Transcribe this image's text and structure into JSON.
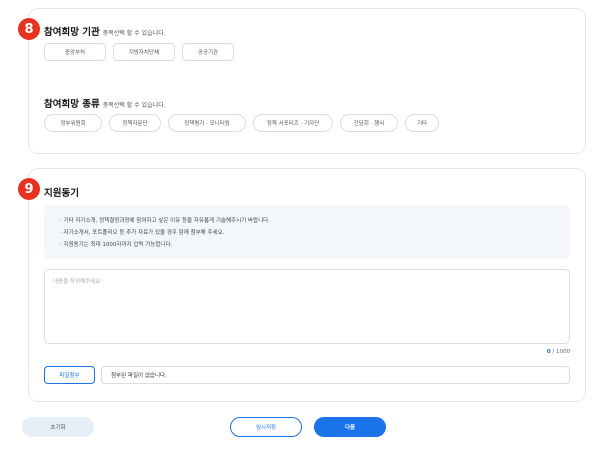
{
  "steps": {
    "org_step": "8",
    "motive_step": "9"
  },
  "org_section": {
    "title": "참여희망 기관",
    "subtitle": "중복선택 할 수 있습니다.",
    "options": [
      "중앙부처",
      "지방자치단체",
      "공공기관"
    ]
  },
  "type_section": {
    "title": "참여희망 종류",
    "subtitle": "중복선택 할 수 있습니다.",
    "options": [
      "정부위원회",
      "정책자문단",
      "정책평가 · 모니터링",
      "정책 서포터즈 · 기자단",
      "간담회 · 행사",
      "기타"
    ]
  },
  "motive_section": {
    "title": "지원동기",
    "info_lines": [
      "· 기타 자기소개, 정책결정과정에 참여하고 싶은 이유 등을 자유롭게 기술해주시기 바랍니다.",
      "· 자기소개서, 포트폴리오 등 추가 자료가 있을 경우 함께 첨부해 주세요.",
      "· 지원동기는 최대 1000자까지 입력 가능합니다."
    ],
    "textarea_placeholder": "내용을 작성해주세요",
    "textarea_value": "",
    "char_count": "0",
    "char_max": " / 1000",
    "file_button": "파일첨부",
    "file_status": "첨부된 파일이 없습니다."
  },
  "footer": {
    "reset_label": "초기화",
    "draft_label": "임시저장",
    "next_label": "다음"
  },
  "colors": {
    "accent": "#1a73e8",
    "step_badge": "#e8321f",
    "reset_bg": "#e5edf7",
    "info_bg": "#f3f6fa"
  }
}
